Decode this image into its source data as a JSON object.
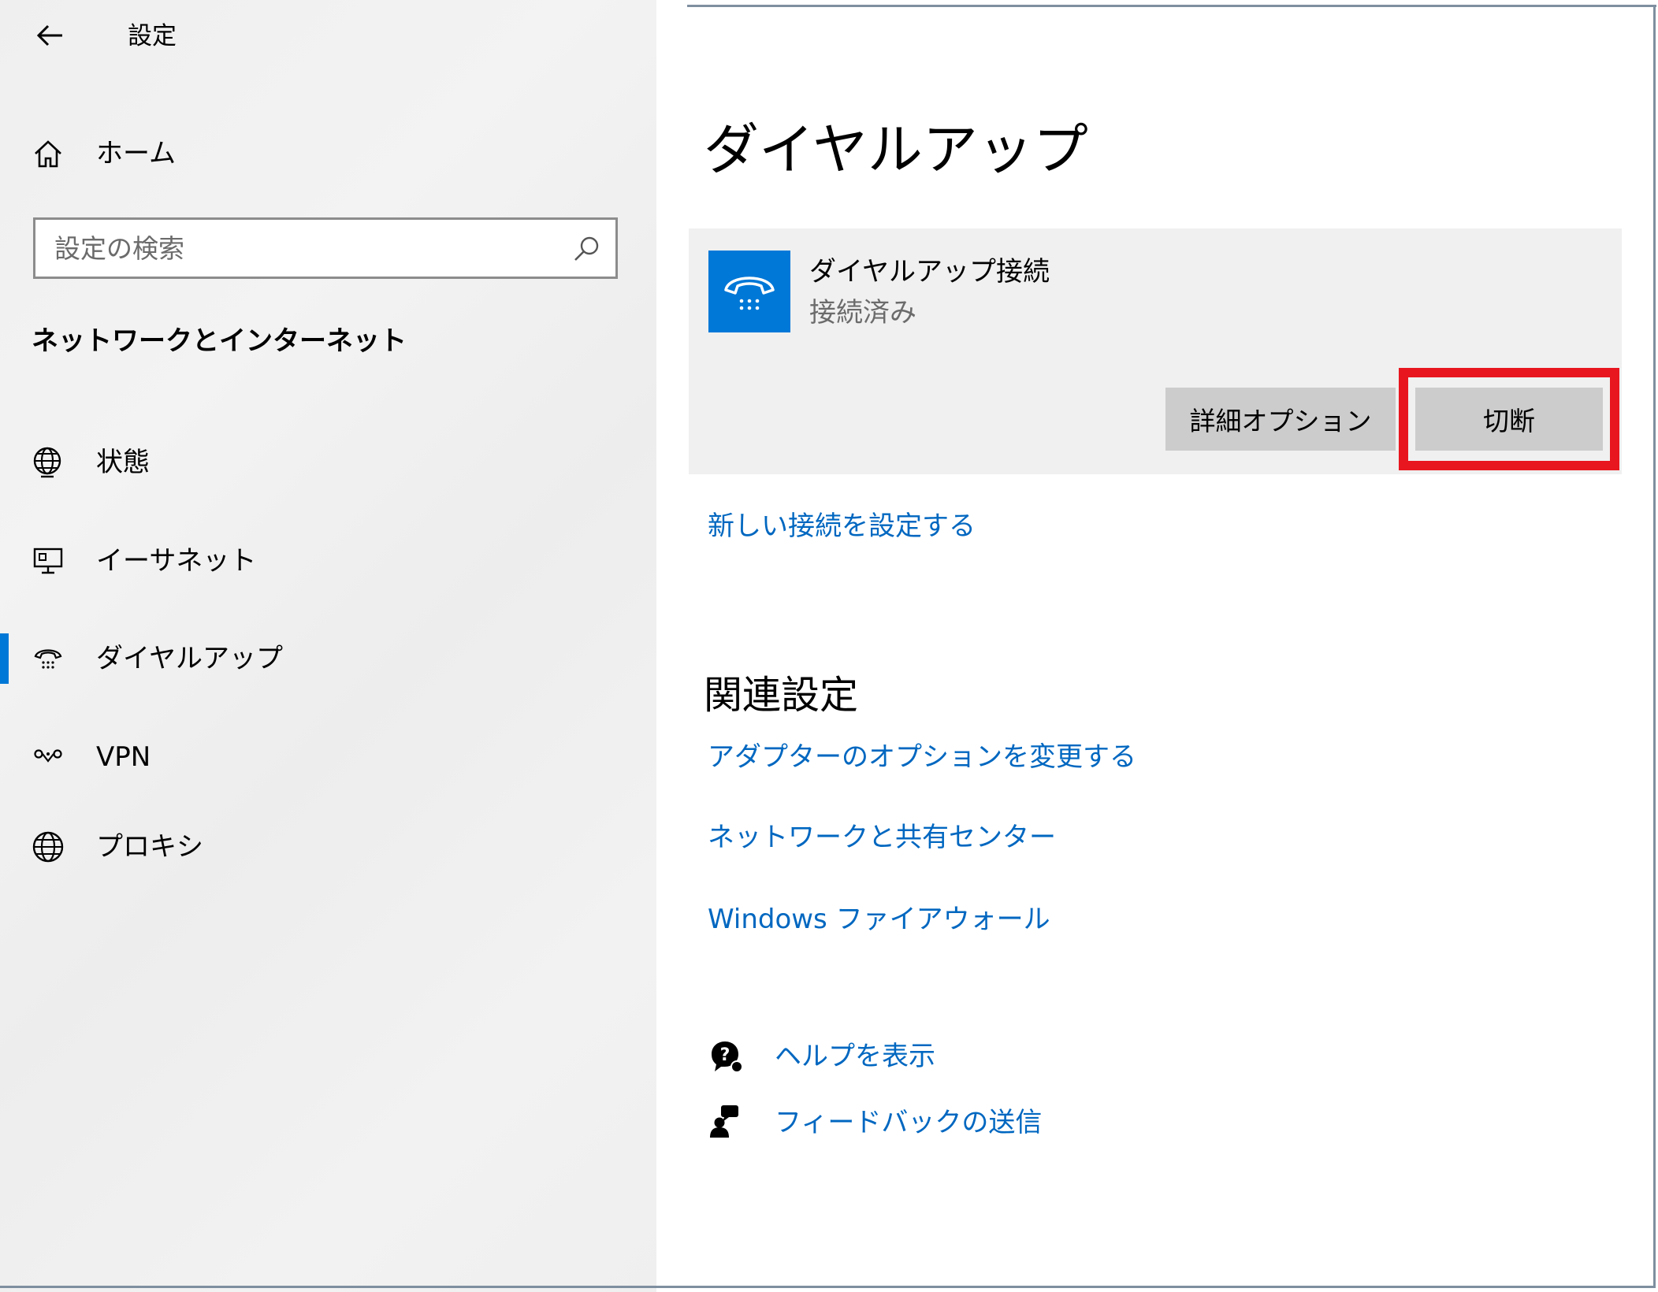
{
  "window": {
    "app_title": "設定"
  },
  "sidebar": {
    "home_label": "ホーム",
    "search_placeholder": "設定の検索",
    "section_title": "ネットワークとインターネット",
    "items": [
      {
        "label": "状態",
        "icon": "globe-status-icon",
        "selected": false
      },
      {
        "label": "イーサネット",
        "icon": "ethernet-icon",
        "selected": false
      },
      {
        "label": "ダイヤルアップ",
        "icon": "dialup-icon",
        "selected": true
      },
      {
        "label": "VPN",
        "icon": "vpn-icon",
        "selected": false
      },
      {
        "label": "プロキシ",
        "icon": "globe-icon",
        "selected": false
      }
    ]
  },
  "main": {
    "page_title": "ダイヤルアップ",
    "connection": {
      "name": "ダイヤルアップ接続",
      "status": "接続済み",
      "icon": "phone-icon",
      "advanced_button": "詳細オプション",
      "disconnect_button": "切断"
    },
    "new_connection_link": "新しい接続を設定する",
    "related": {
      "title": "関連設定",
      "links": [
        "アダプターのオプションを変更する",
        "ネットワークと共有センター",
        "Windows ファイアウォール"
      ]
    },
    "help": {
      "show_help": "ヘルプを表示",
      "send_feedback": "フィードバックの送信"
    }
  },
  "colors": {
    "accent": "#0078d7",
    "link": "#0067c0",
    "highlight": "#e8161f",
    "card_bg": "#f0f0f0",
    "button_bg": "#cccccc"
  }
}
